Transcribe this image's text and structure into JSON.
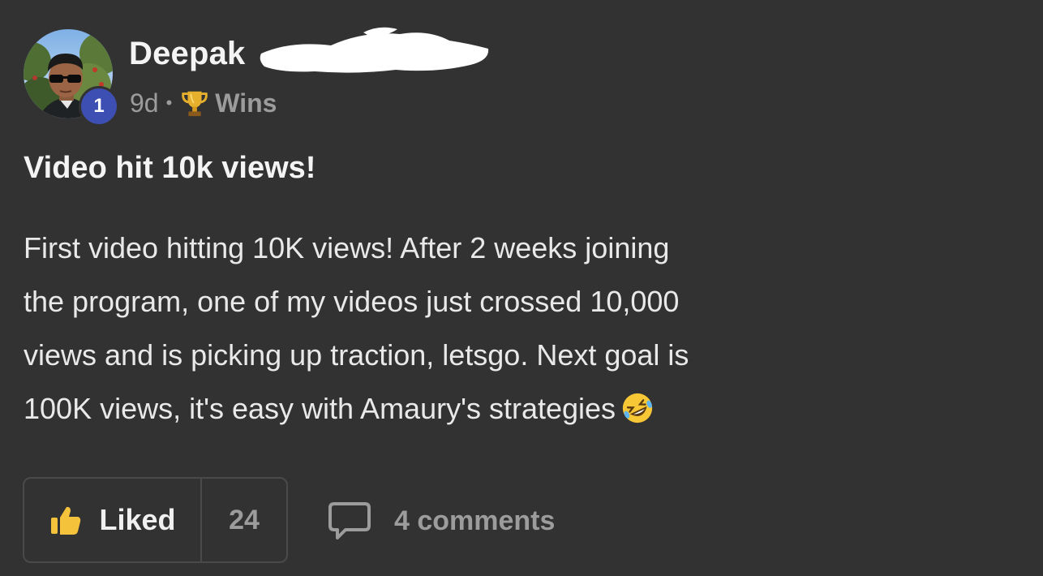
{
  "author": {
    "name": "Deepak",
    "level": "1",
    "avatar_icon": "avatar-photo"
  },
  "meta": {
    "age": "9d",
    "separator": "•",
    "category_icon": "trophy-icon",
    "category": "Wins"
  },
  "post": {
    "title": "Video hit 10k views!",
    "body_lines": [
      "First video hitting 10K views! After 2 weeks joining",
      "the program, one of my videos just crossed 10,000",
      "views and is picking up traction, letsgo. Next goal is",
      "100K views, it's easy with Amaury's strategies"
    ],
    "emoji_icon": "rolling-laughing-emoji"
  },
  "actions": {
    "like_label": "Liked",
    "like_count": "24",
    "like_icon": "thumbs-up-icon",
    "comments_label": "4 comments",
    "comments_icon": "comment-icon"
  },
  "colors": {
    "background": "#323232",
    "level_badge": "#3d4fb3",
    "muted_text": "#9c9c9c",
    "like_yellow": "#f5c33b",
    "border": "#4a4a4a"
  }
}
